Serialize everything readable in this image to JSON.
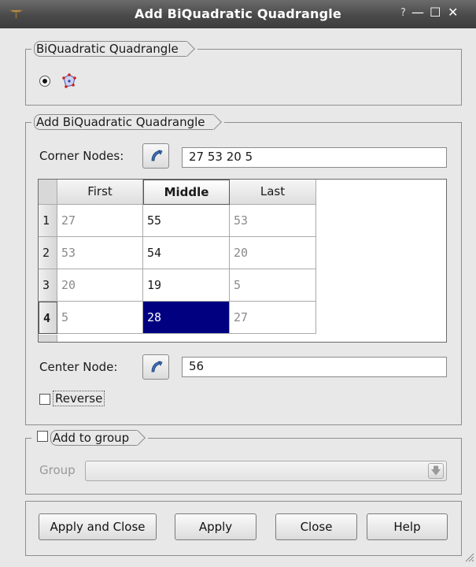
{
  "window": {
    "title": "Add BiQuadratic Quadrangle",
    "help": "?",
    "minimize": "—",
    "maximize": "☐",
    "close": "✕"
  },
  "element_group": {
    "title": "BiQuadratic Quadrangle",
    "selected_icon": "biquadratic-quadrangle-icon"
  },
  "args_group": {
    "title": "Add BiQuadratic Quadrangle",
    "corner_nodes_label": "Corner Nodes:",
    "corner_nodes_value": "27 53 20 5",
    "table": {
      "headers": [
        "First",
        "Middle",
        "Last"
      ],
      "active_header": "Middle",
      "rows": [
        {
          "num": "1",
          "first": "27",
          "middle": "55",
          "last": "53"
        },
        {
          "num": "2",
          "first": "53",
          "middle": "54",
          "last": "20"
        },
        {
          "num": "3",
          "first": "20",
          "middle": "19",
          "last": "5"
        },
        {
          "num": "4",
          "first": "5",
          "middle": "28",
          "last": "27"
        }
      ],
      "selected_row": "4",
      "selected_column": "Middle"
    },
    "center_node_label": "Center Node:",
    "center_node_value": "56",
    "reverse_label": "Reverse",
    "reverse_checked": false
  },
  "group_box": {
    "title": "Add to group",
    "checked": false,
    "group_label": "Group",
    "group_value": ""
  },
  "buttons": {
    "apply_close": "Apply and Close",
    "apply": "Apply",
    "close": "Close",
    "help": "Help"
  },
  "colors": {
    "selection": "#000080",
    "titlebar": "#4a4a4a",
    "background": "#e8e8e8"
  }
}
